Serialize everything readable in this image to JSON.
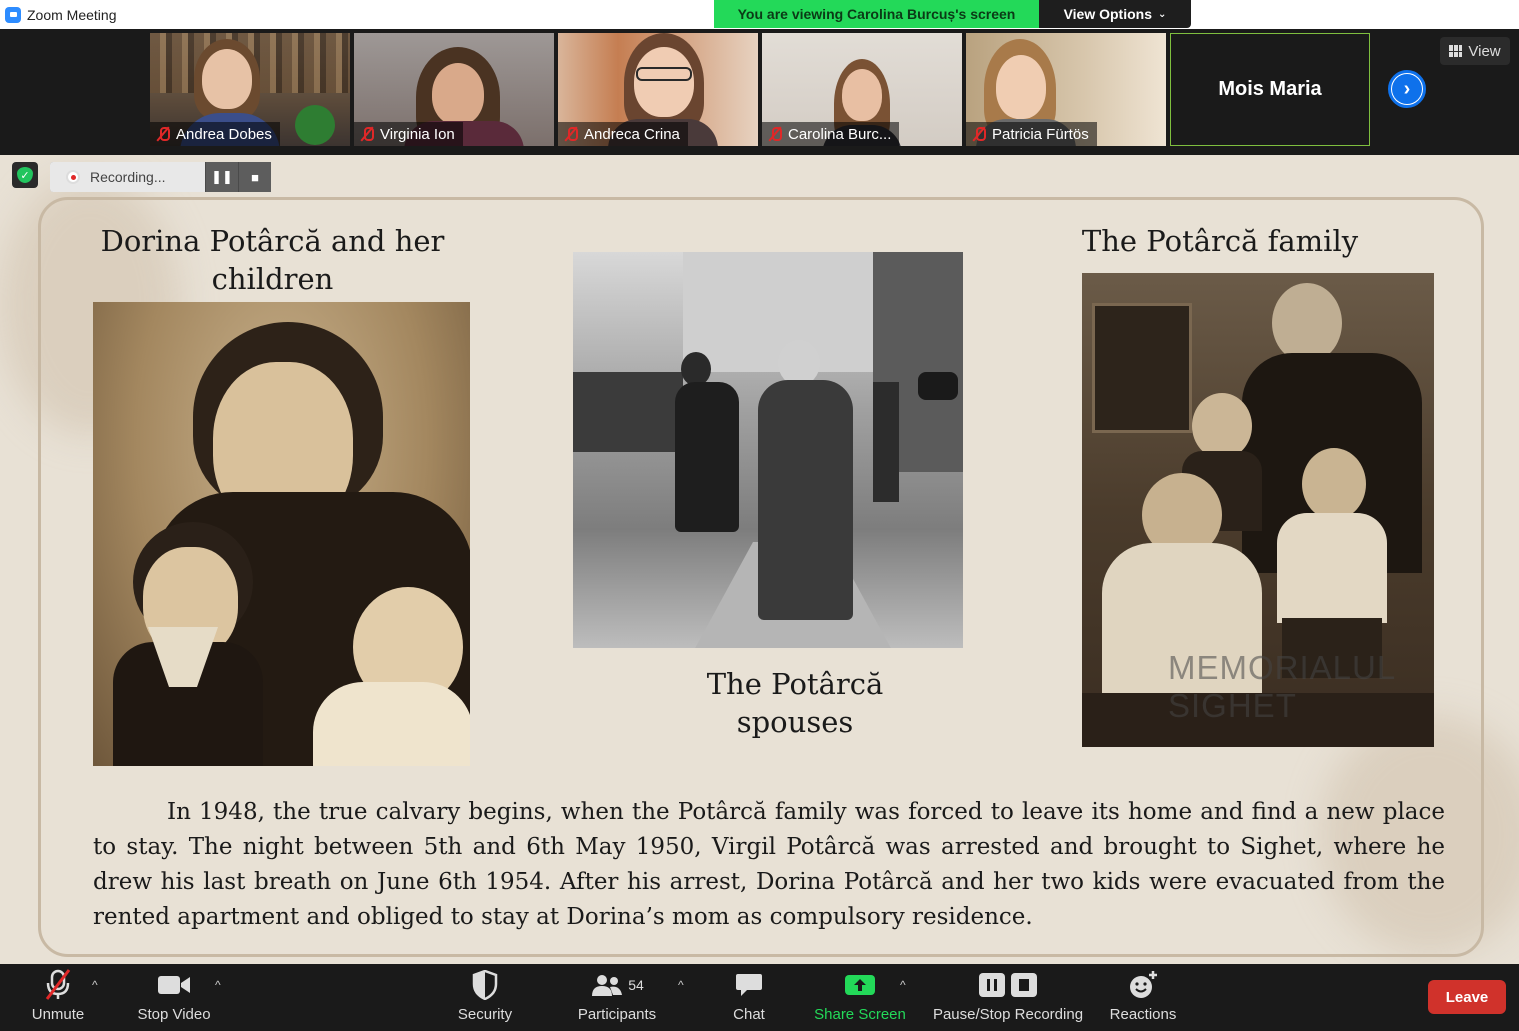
{
  "window": {
    "title": "Zoom Meeting"
  },
  "banner": {
    "viewing": "You are viewing Carolina Burcuș's screen",
    "view_options": "View Options"
  },
  "participants": [
    {
      "name": "Andrea Dobes"
    },
    {
      "name": "Virginia Ion"
    },
    {
      "name": "Andreca Crina"
    },
    {
      "name": "Carolina Burc..."
    },
    {
      "name": "Patricia Fürtös"
    }
  ],
  "named_tile": {
    "name": "Mois Maria"
  },
  "view_button": {
    "label": "View"
  },
  "recording": {
    "label": "Recording...",
    "pause_icon": "pause-icon",
    "stop_icon": "stop-icon"
  },
  "slide": {
    "caption_left": "Dorina Potârcă and her children",
    "caption_center": "The Potârcă spouses",
    "caption_right": "The Potârcă family",
    "watermark": "MEMORIALUL SIGHET",
    "body": "In 1948, the true calvary begins, when the Potârcă family was forced to leave its home and find a new place to stay. The night between 5th and 6th May 1950, Virgil Potârcă was arrested and brought to Sighet, where he drew his last breath on June 6th 1954. After his arrest, Dorina Potârcă and her two kids were evacuated from the rented apartment and obliged to stay at Dorina’s mom as compulsory residence."
  },
  "toolbar": {
    "unmute": "Unmute",
    "stop_video": "Stop Video",
    "security": "Security",
    "participants": "Participants",
    "participants_count": "54",
    "chat": "Chat",
    "share_screen": "Share Screen",
    "pause_stop_recording": "Pause/Stop Recording",
    "reactions": "Reactions",
    "leave": "Leave"
  },
  "colors": {
    "share_green": "#23d959",
    "accent_blue": "#0e71eb",
    "leave_red": "#d0322b",
    "slide_bg": "#e8e1d5"
  }
}
